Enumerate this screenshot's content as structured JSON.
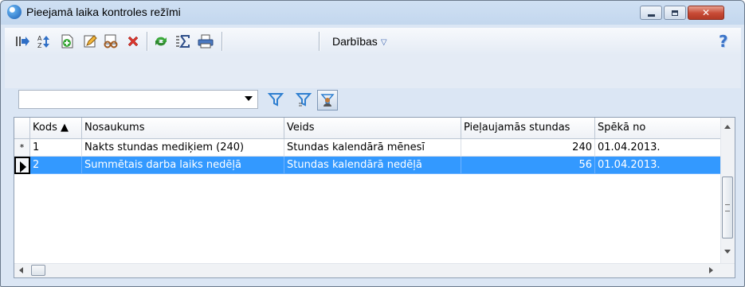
{
  "window": {
    "title": "Pieejamā laika kontroles režīmi",
    "close_label": "✕"
  },
  "toolbar": {
    "icons": [
      "export-icon",
      "sort-icon",
      "add-icon",
      "edit-icon",
      "view-icon",
      "delete-icon",
      "refresh-icon",
      "sum-icon",
      "print-icon"
    ],
    "actions_label": "Darbības",
    "help_label": "?"
  },
  "filter": {
    "value": "",
    "icons": [
      "filter-icon",
      "filter-edit-icon",
      "filter-user-icon"
    ]
  },
  "grid": {
    "columns": [
      {
        "label": "Kods ▲"
      },
      {
        "label": "Nosaukums"
      },
      {
        "label": "Veids"
      },
      {
        "label": "Pieļaujamās stundas"
      },
      {
        "label": "Spēkā no"
      }
    ],
    "rows": [
      {
        "indicator": "*",
        "kods": "1",
        "nosaukums": "Nakts stundas mediķiem (240)",
        "veids": "Stundas kalendārā mēnesī",
        "stundas": "240",
        "speka_no": "01.04.2013.",
        "selected": false
      },
      {
        "indicator": "▶",
        "kods": "2",
        "nosaukums": "Summētais darba laiks nedēļā",
        "veids": "Stundas kalendārā nedēļā",
        "stundas": "56",
        "speka_no": "01.04.2013.",
        "selected": true
      }
    ]
  },
  "colors": {
    "selection": "#3399ff",
    "accent": "#3a63b0"
  }
}
